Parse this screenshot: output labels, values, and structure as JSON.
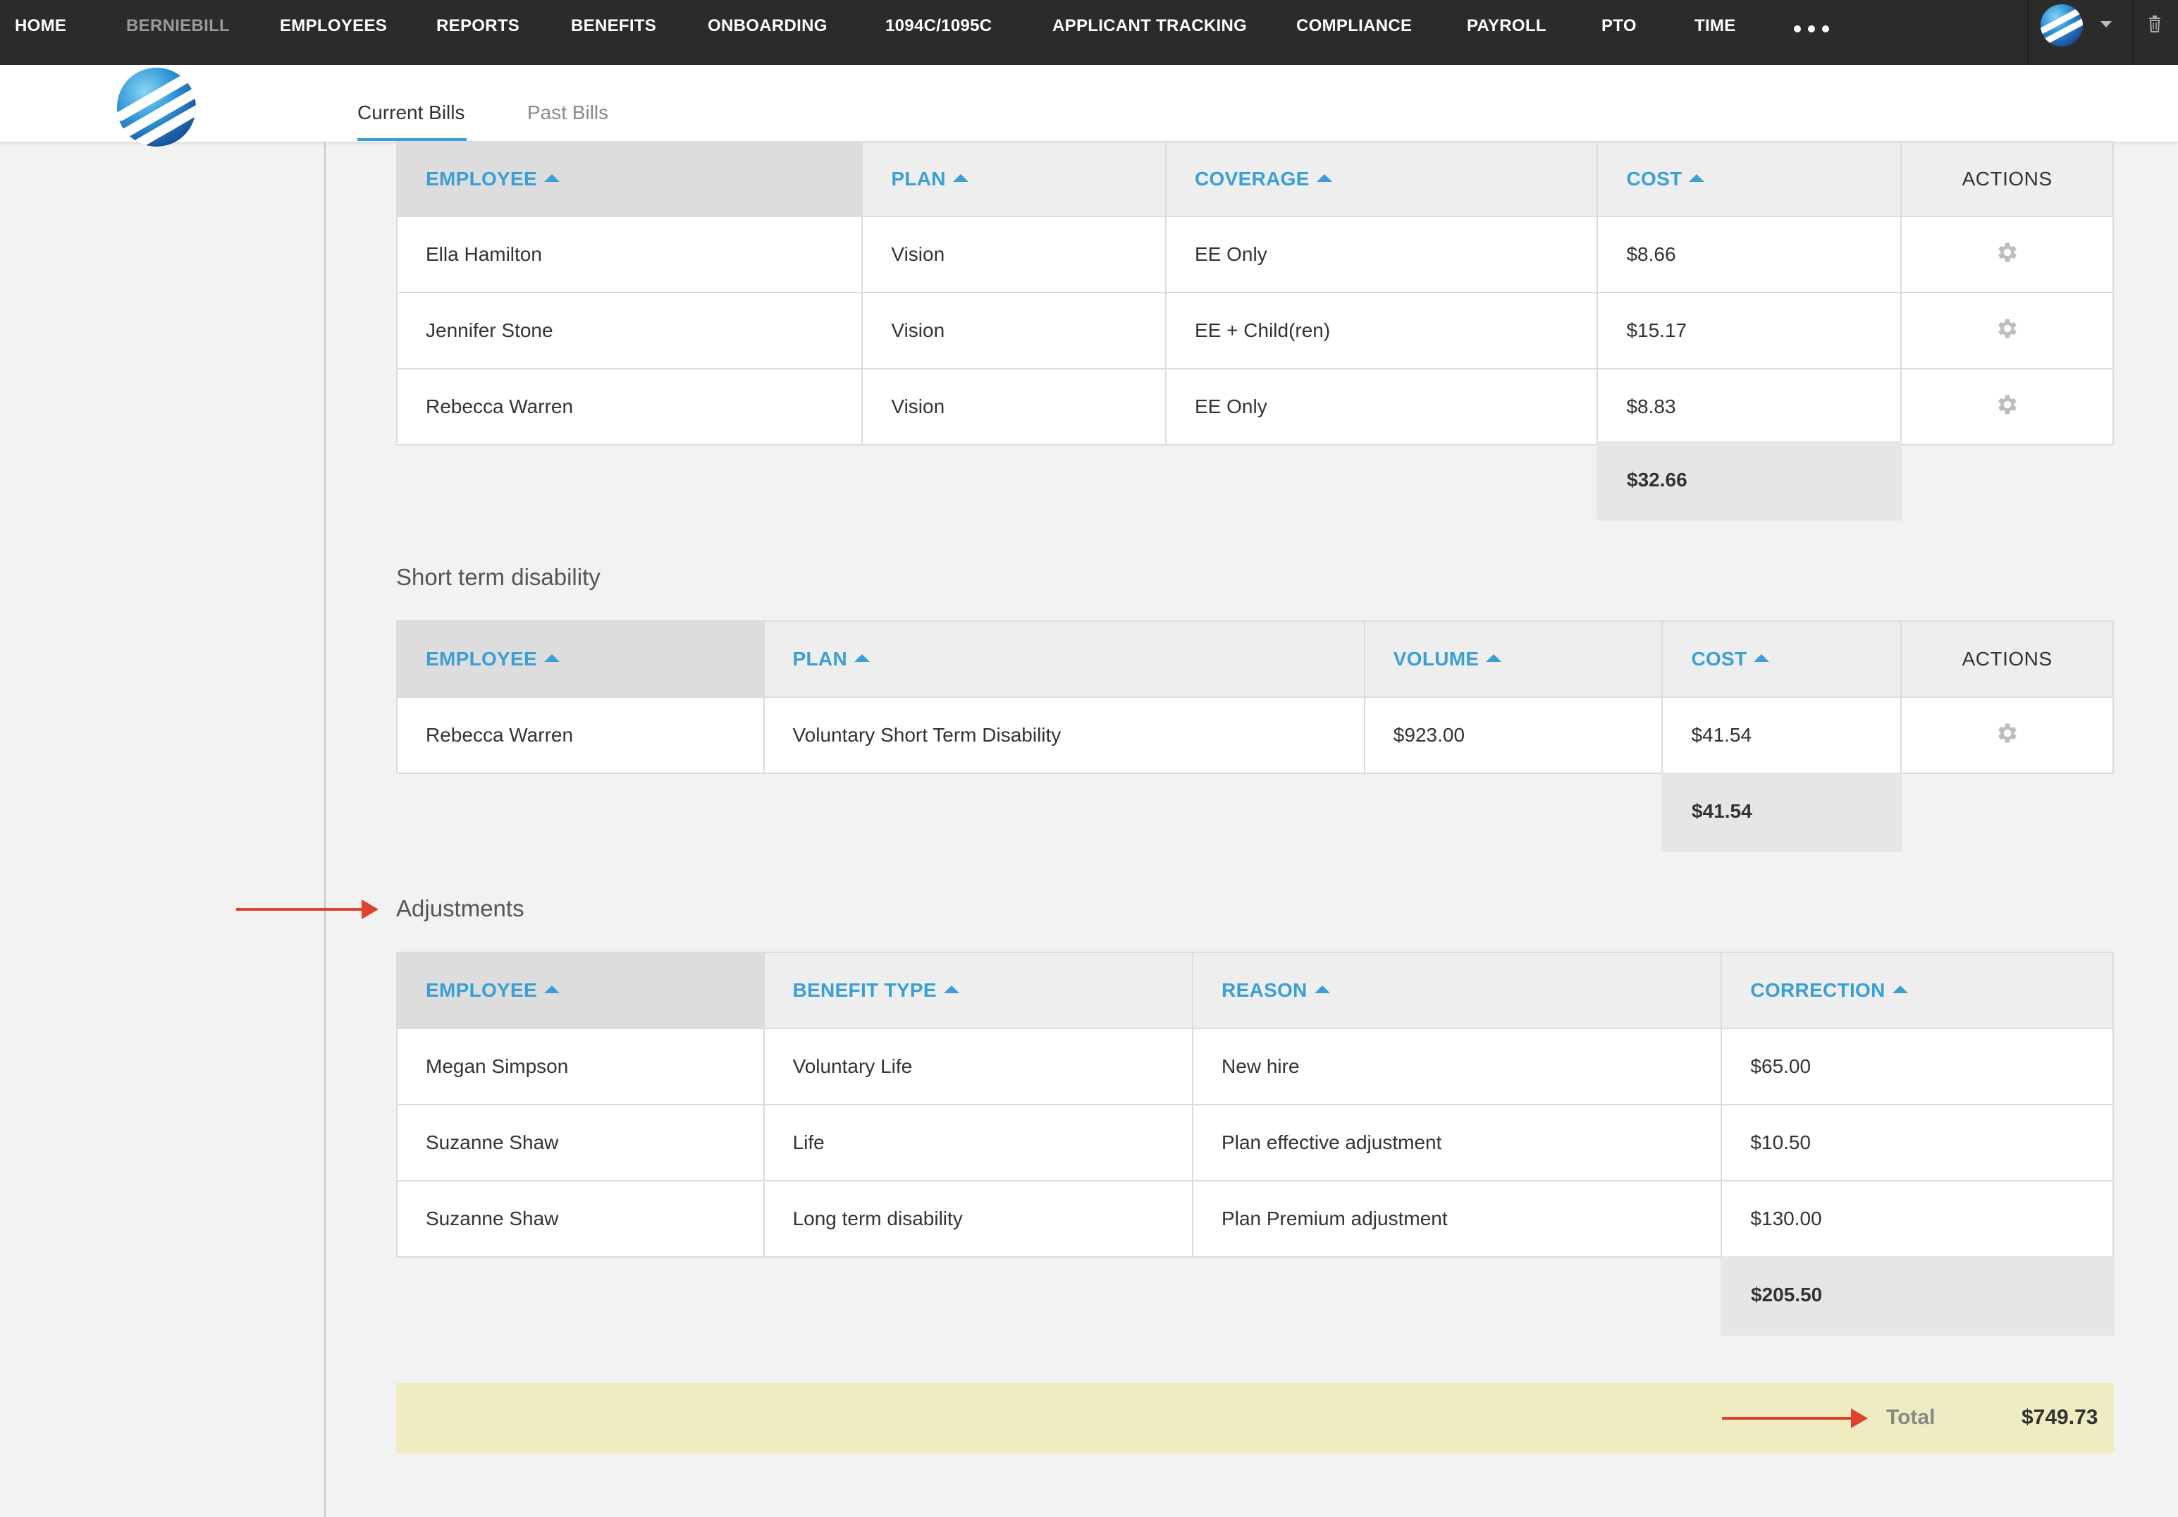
{
  "nav": {
    "items": [
      {
        "label": "HOME"
      },
      {
        "label": "BERNIEBILL"
      },
      {
        "label": "EMPLOYEES"
      },
      {
        "label": "REPORTS"
      },
      {
        "label": "BENEFITS"
      },
      {
        "label": "ONBOARDING"
      },
      {
        "label": "1094C/1095C"
      },
      {
        "label": "APPLICANT TRACKING"
      },
      {
        "label": "COMPLIANCE"
      },
      {
        "label": "PAYROLL"
      },
      {
        "label": "PTO"
      },
      {
        "label": "TIME"
      }
    ],
    "active": "BERNIEBILL"
  },
  "subnav": {
    "tabs": [
      {
        "label": "Current Bills"
      },
      {
        "label": "Past Bills"
      }
    ],
    "active": "Current Bills"
  },
  "vision": {
    "headers": [
      "EMPLOYEE",
      "PLAN",
      "COVERAGE",
      "COST",
      "ACTIONS"
    ],
    "rows": [
      {
        "employee": "Ella Hamilton",
        "plan": "Vision",
        "coverage": "EE Only",
        "cost": "$8.66"
      },
      {
        "employee": "Jennifer Stone",
        "plan": "Vision",
        "coverage": "EE + Child(ren)",
        "cost": "$15.17"
      },
      {
        "employee": "Rebecca Warren",
        "plan": "Vision",
        "coverage": "EE Only",
        "cost": "$8.83"
      }
    ],
    "subtotal": "$32.66"
  },
  "std": {
    "title": "Short term disability",
    "headers": [
      "EMPLOYEE",
      "PLAN",
      "VOLUME",
      "COST",
      "ACTIONS"
    ],
    "rows": [
      {
        "employee": "Rebecca Warren",
        "plan": "Voluntary Short Term Disability",
        "volume": "$923.00",
        "cost": "$41.54"
      }
    ],
    "subtotal": "$41.54"
  },
  "adjustments": {
    "title": "Adjustments",
    "headers": [
      "EMPLOYEE",
      "BENEFIT TYPE",
      "REASON",
      "CORRECTION"
    ],
    "rows": [
      {
        "employee": "Megan Simpson",
        "benefit_type": "Voluntary Life",
        "reason": "New hire",
        "correction": "$65.00"
      },
      {
        "employee": "Suzanne Shaw",
        "benefit_type": "Life",
        "reason": "Plan effective adjustment",
        "correction": "$10.50"
      },
      {
        "employee": "Suzanne Shaw",
        "benefit_type": "Long term disability",
        "reason": "Plan Premium adjustment",
        "correction": "$130.00"
      }
    ],
    "subtotal": "$205.50"
  },
  "total": {
    "label": "Total",
    "value": "$749.73"
  },
  "colors": {
    "nav_bg": "#2b2b2b",
    "link_blue": "#3a9fd6",
    "total_bar": "#f0ecc2",
    "annotation_red": "#e0412f"
  },
  "icons": [
    "more-dots-icon",
    "avatar-globe-icon",
    "caret-down-icon",
    "trash-icon",
    "gear-icon",
    "sort-asc-icon",
    "logo-globe-icon"
  ]
}
